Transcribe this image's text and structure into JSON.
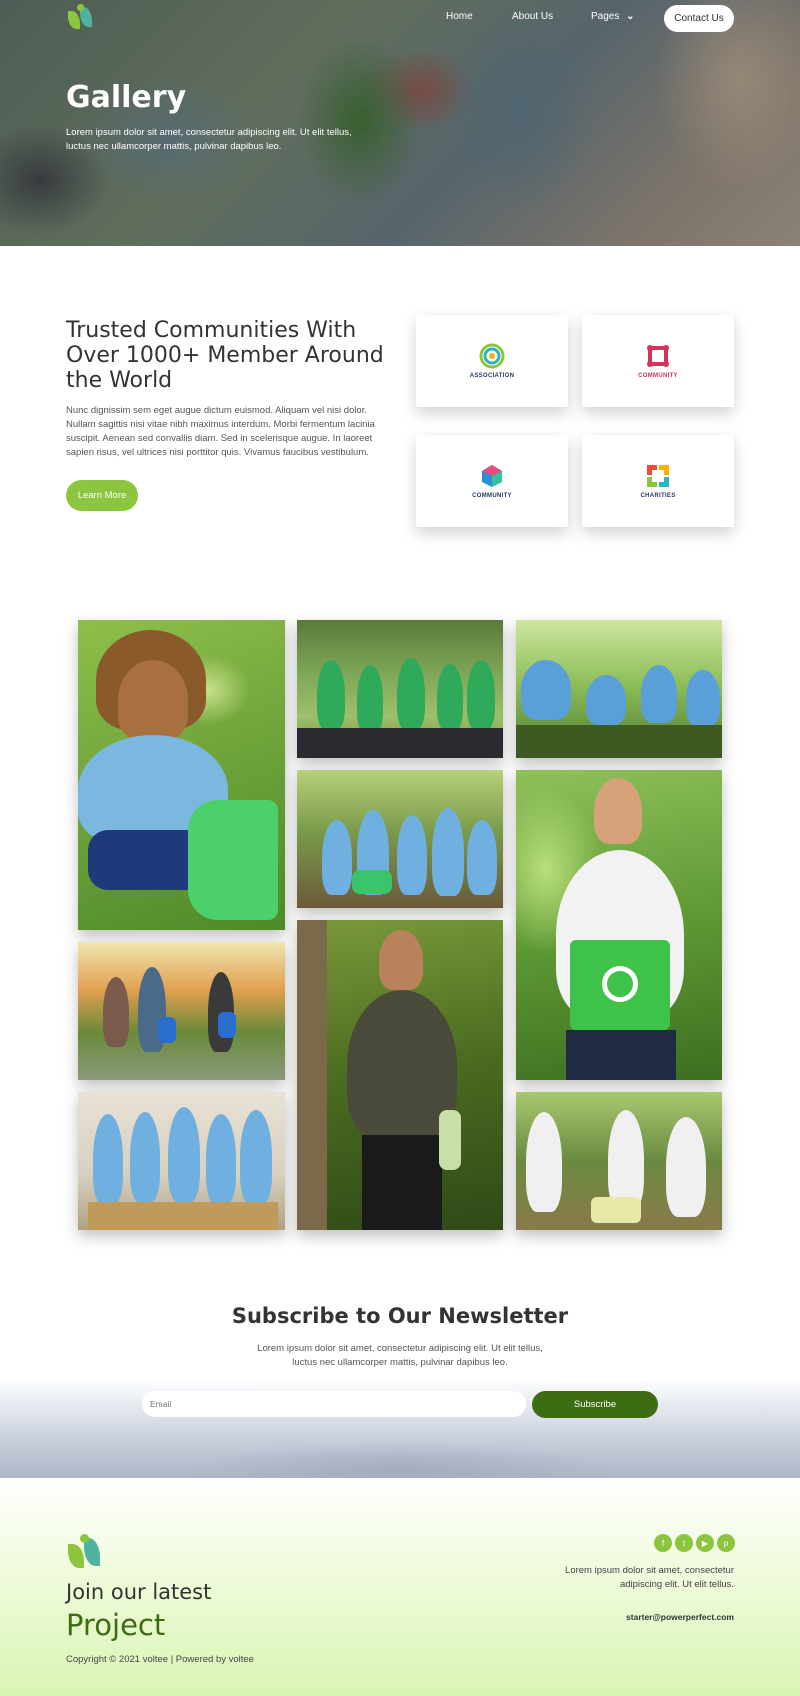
{
  "nav": {
    "home": "Home",
    "about": "About Us",
    "pages": "Pages",
    "pages_chevron": "⌄",
    "contact": "Contact Us"
  },
  "hero": {
    "title": "Gallery",
    "text": "Lorem ipsum dolor sit amet, consectetur adipiscing elit. Ut elit tellus, luctus nec ullamcorper mattis, pulvinar dapibus leo."
  },
  "about": {
    "title": "Trusted Communities With Over 1000+ Member Around the World",
    "text": "Nunc dignissim sem eget augue dictum euismod. Aliquam vel nisi dolor. Nullam sagittis nisi vitae nibh maximus interdum. Morbi fermentum lacinia suscipit. Aenean sed convallis diam. Sed in scelerisque augue. In laoreet sapien risus, vel ultrices nisi porttitor quis. Vivamus faucibus vestibulum.",
    "button": "Learn More"
  },
  "partners": [
    {
      "name": "ASSOCIATION",
      "icon": "association-logo"
    },
    {
      "name": "COMMUNITY",
      "icon": "community-logo-red"
    },
    {
      "name": "COMMUNITY",
      "icon": "community-logo-blue"
    },
    {
      "name": "CHARITIES",
      "icon": "charities-logo"
    }
  ],
  "newsletter": {
    "title": "Subscribe to Our Newsletter",
    "text": "Lorem ipsum dolor sit amet, consectetur adipiscing elit. Ut elit tellus, luctus nec ullamcorper mattis, pulvinar dapibus leo.",
    "email_placeholder": "Email",
    "button": "Subscribe"
  },
  "footer": {
    "join_line1": "Join our latest",
    "join_line2": "Project",
    "copyright": "Copyright © 2021 voltee | Powered by voltee",
    "text": "Lorem ipsum dolor sit amet, consectetur adipiscing elit. Ut elit tellus.",
    "email": "starter@powerperfect.com",
    "social": [
      {
        "icon": "facebook-icon",
        "glyph": "f"
      },
      {
        "icon": "twitter-icon",
        "glyph": "t"
      },
      {
        "icon": "youtube-icon",
        "glyph": "▶"
      },
      {
        "icon": "pinterest-icon",
        "glyph": "p"
      }
    ]
  },
  "colors": {
    "brand_green": "#8cc63f",
    "dark_green": "#3c6d12"
  }
}
